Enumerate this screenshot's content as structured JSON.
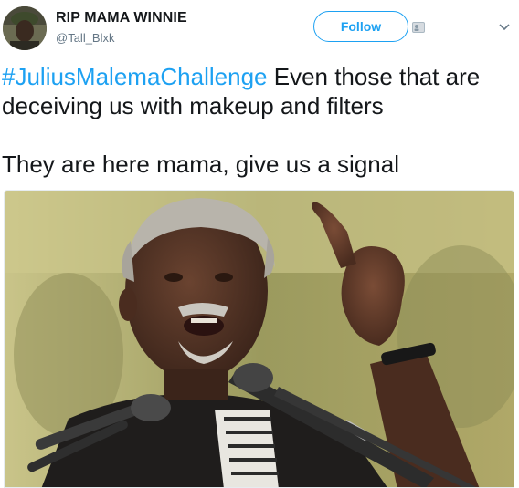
{
  "tweet": {
    "author_name": "RIP MAMA WINNIE",
    "author_handle": "@Tall_Blxk",
    "follow_label": "Follow",
    "hashtag": "#JuliusMalemaChallenge",
    "line1_rest": " Even those that are deceiving us with makeup and filters",
    "line2": "They are here mama, give us a signal"
  },
  "icons": {
    "follow_badge": "person-add-icon",
    "menu": "chevron-down-icon"
  },
  "colors": {
    "accent": "#1da1f2",
    "text": "#14171a",
    "secondary": "#657786"
  }
}
